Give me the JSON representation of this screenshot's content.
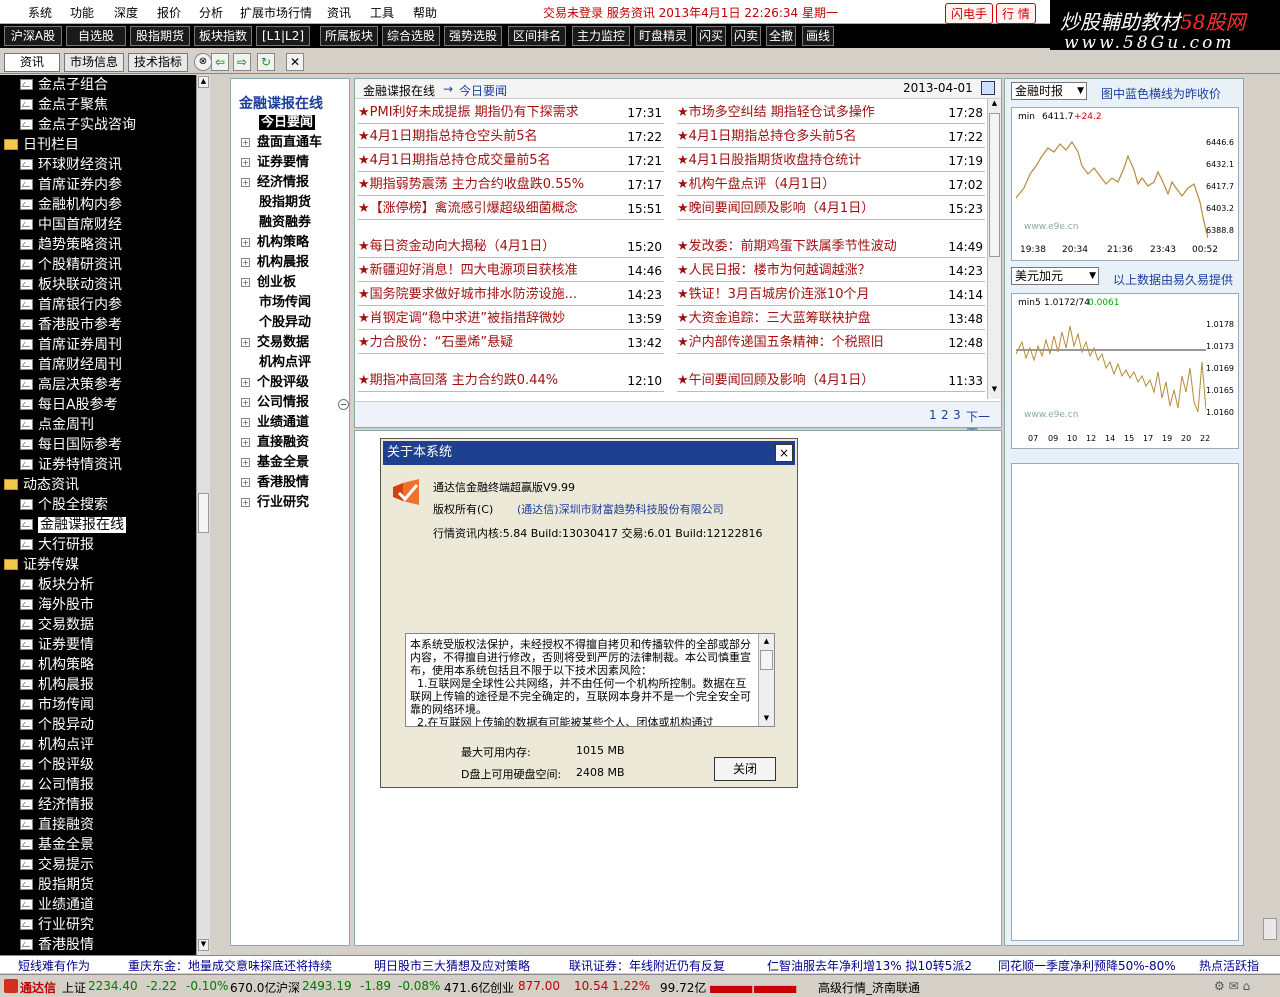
{
  "menu": {
    "items": [
      "系统",
      "功能",
      "深度",
      "报价",
      "分析",
      "扩展市场行情",
      "资讯",
      "工具",
      "帮助"
    ],
    "status": "交易未登录  服务资讯  2013年4月1日 22:26:34 星期一",
    "flash_btn": "闪电手",
    "quote_btn": "行 情"
  },
  "watermark": {
    "line1a": "炒股輔助教材",
    "line1b": "58股网",
    "line2": "www.58Gu.com"
  },
  "toolbar": [
    "沪深A股",
    "自选股",
    "股指期货",
    "板块指数",
    "[L1|L2]",
    "所属板块",
    "综合选股",
    "强势选股",
    "区间排名",
    "主力监控",
    "盯盘精灵",
    "闪买",
    "闪卖",
    "全撤",
    "画线"
  ],
  "tabs": {
    "info": "资讯",
    "market": "市场信息",
    "tech": "技术指标"
  },
  "left_tree": [
    {
      "label": "金点子组合",
      "type": "leaf"
    },
    {
      "label": "金点子聚焦",
      "type": "leaf"
    },
    {
      "label": "金点子实战咨询",
      "type": "leaf"
    },
    {
      "label": "日刊栏目",
      "type": "folder"
    },
    {
      "label": "环球财经资讯",
      "type": "leaf"
    },
    {
      "label": "首席证券内参",
      "type": "leaf"
    },
    {
      "label": "金融机构内参",
      "type": "leaf"
    },
    {
      "label": "中国首席财经",
      "type": "leaf"
    },
    {
      "label": "趋势策略资讯",
      "type": "leaf"
    },
    {
      "label": "个股精研资讯",
      "type": "leaf"
    },
    {
      "label": "板块联动资讯",
      "type": "leaf"
    },
    {
      "label": "首席银行内参",
      "type": "leaf"
    },
    {
      "label": "香港股市参考",
      "type": "leaf"
    },
    {
      "label": "首席证券周刊",
      "type": "leaf"
    },
    {
      "label": "首席财经周刊",
      "type": "leaf"
    },
    {
      "label": "高层决策参考",
      "type": "leaf"
    },
    {
      "label": "每日A股参考",
      "type": "leaf"
    },
    {
      "label": "点金周刊",
      "type": "leaf"
    },
    {
      "label": "每日国际参考",
      "type": "leaf"
    },
    {
      "label": "证券特情资讯",
      "type": "leaf"
    },
    {
      "label": "动态资讯",
      "type": "folder"
    },
    {
      "label": "个股全搜索",
      "type": "leaf"
    },
    {
      "label": "金融谍报在线",
      "type": "leaf",
      "selected": true
    },
    {
      "label": "大行研报",
      "type": "leaf"
    },
    {
      "label": "证券传媒",
      "type": "folder"
    },
    {
      "label": "板块分析",
      "type": "leaf"
    },
    {
      "label": "海外股市",
      "type": "leaf"
    },
    {
      "label": "交易数据",
      "type": "leaf"
    },
    {
      "label": "证券要情",
      "type": "leaf"
    },
    {
      "label": "机构策略",
      "type": "leaf"
    },
    {
      "label": "机构晨报",
      "type": "leaf"
    },
    {
      "label": "市场传闻",
      "type": "leaf"
    },
    {
      "label": "个股异动",
      "type": "leaf"
    },
    {
      "label": "机构点评",
      "type": "leaf"
    },
    {
      "label": "个股评级",
      "type": "leaf"
    },
    {
      "label": "公司情报",
      "type": "leaf"
    },
    {
      "label": "经济情报",
      "type": "leaf"
    },
    {
      "label": "直接融资",
      "type": "leaf"
    },
    {
      "label": "基金全景",
      "type": "leaf"
    },
    {
      "label": "交易提示",
      "type": "leaf"
    },
    {
      "label": "股指期货",
      "type": "leaf"
    },
    {
      "label": "业绩通道",
      "type": "leaf"
    },
    {
      "label": "行业研究",
      "type": "leaf"
    },
    {
      "label": "香港股情",
      "type": "leaf"
    }
  ],
  "category": {
    "title": "金融谍报在线",
    "items": [
      {
        "label": "今日要闻",
        "expand": false,
        "selected": true
      },
      {
        "label": "盘面直通车",
        "expand": true
      },
      {
        "label": "证券要情",
        "expand": true
      },
      {
        "label": "经济情报",
        "expand": true
      },
      {
        "label": "股指期货",
        "expand": false
      },
      {
        "label": "融资融券",
        "expand": false
      },
      {
        "label": "机构策略",
        "expand": true
      },
      {
        "label": "机构晨报",
        "expand": true
      },
      {
        "label": "创业板",
        "expand": true
      },
      {
        "label": "市场传闻",
        "expand": false
      },
      {
        "label": "个股异动",
        "expand": false
      },
      {
        "label": "交易数据",
        "expand": true
      },
      {
        "label": "机构点评",
        "expand": false
      },
      {
        "label": "个股评级",
        "expand": true
      },
      {
        "label": "公司情报",
        "expand": true
      },
      {
        "label": "业绩通道",
        "expand": true
      },
      {
        "label": "直接融资",
        "expand": true
      },
      {
        "label": "基金全景",
        "expand": true
      },
      {
        "label": "香港股情",
        "expand": true
      },
      {
        "label": "行业研究",
        "expand": true
      }
    ]
  },
  "news": {
    "breadcrumb_root": "金融谍报在线",
    "arrow": "→",
    "breadcrumb_current": "今日要闻",
    "date": "2013-04-01",
    "left": [
      {
        "title": "★PMI利好未成提振 期指仍有下探需求",
        "time": "17:31"
      },
      {
        "title": "★4月1日期指总持仓空头前5名",
        "time": "17:22"
      },
      {
        "title": "★4月1日期指总持仓成交量前5名",
        "time": "17:21"
      },
      {
        "title": "★期指弱势震荡 主力合约收盘跌0.55%",
        "time": "17:17"
      },
      {
        "title": "★【涨停榜】禽流感引爆超级细菌概念",
        "time": "15:51"
      },
      {
        "title": "★每日资金动向大揭秘（4月1日）",
        "time": "15:20"
      },
      {
        "title": "★新疆迎好消息！四大电源项目获核准",
        "time": "14:46"
      },
      {
        "title": "★国务院要求做好城市排水防涝设施...",
        "time": "14:23"
      },
      {
        "title": "★肖钢定调“稳中求进”被指措辞微妙",
        "time": "13:59"
      },
      {
        "title": "★力合股份：“石墨烯”悬疑",
        "time": "13:42"
      },
      {
        "title": "★期指冲高回落 主力合约跌0.44%",
        "time": "12:10"
      }
    ],
    "right": [
      {
        "title": "★市场多空纠结 期指轻仓试多操作",
        "time": "17:28"
      },
      {
        "title": "★4月1日期指总持仓多头前5名",
        "time": "17:22"
      },
      {
        "title": "★4月1日股指期货收盘持仓统计",
        "time": "17:19"
      },
      {
        "title": "★机构午盘点评（4月1日）",
        "time": "17:02"
      },
      {
        "title": "★晚间要闻回顾及影响（4月1日）",
        "time": "15:23"
      },
      {
        "title": "★发改委：前期鸡蛋下跌属季节性波动",
        "time": "14:49"
      },
      {
        "title": "★人民日报：楼市为何越调越涨？",
        "time": "14:23"
      },
      {
        "title": "★铁证！3月百城房价连涨10个月",
        "time": "14:14"
      },
      {
        "title": "★大资金追踪：三大蓝筹联袂护盘",
        "time": "13:48"
      },
      {
        "title": "★沪内部传递国五条精神：个税照旧",
        "time": "12:48"
      },
      {
        "title": "★午间要闻回顾及影响（4月1日）",
        "time": "11:33"
      }
    ],
    "pages": [
      "1",
      "2",
      "3"
    ],
    "next": "下一页"
  },
  "right_panel": {
    "select1": "金融时报",
    "hint1": "图中蓝色横线为昨收价",
    "chart1": {
      "label": "min",
      "price": "6411.7",
      "change": "+24.2",
      "yticks": [
        "6446.6",
        "6432.1",
        "6417.7",
        "6403.2",
        "6388.8"
      ],
      "xticks": [
        "19:38",
        "20:34",
        "21:36",
        "23:43",
        "00:52"
      ],
      "site": "www.e9e.cn"
    },
    "select2": "美元加元",
    "hint2": "以上数据由易久易提供",
    "chart2": {
      "label": "min5",
      "price": "1.0172/74",
      "change": "0.0061",
      "yticks": [
        "1.0178",
        "1.0173",
        "1.0169",
        "1.0165",
        "1.0160"
      ],
      "xticks": [
        "07",
        "09",
        "10",
        "12",
        "14",
        "15",
        "17",
        "19",
        "20",
        "22"
      ],
      "site": "www.e9e.cn"
    }
  },
  "dialog": {
    "title": "关于本系统",
    "close": "×",
    "product": "通达信金融终端超赢版V9.99",
    "copyright_label": "版权所有(C)",
    "copyright_owner": "(通达信)深圳市财富趋势科技股份有限公司",
    "version": "行情资讯内核:5.84 Build:13030417 交易:6.01 Build:12122816",
    "notice": "本系统受版权法保护，未经授权不得擅自拷贝和传播软件的全部或部分内容，不得擅自进行修改，否则将受到严厉的法律制裁。本公司慎重宣布，使用本系统包括且不限于以下技术因素风险：\n  1.互联网是全球性公共网络，并不由任何一个机构所控制。数据在互联网上传输的途径是不完全确定的，互联网本身并不是一个完全安全可靠的网络环境。\n  2.在互联网上传输的数据有可能被某些个人、团体或机构通过",
    "mem_label": "最大可用内存:",
    "mem_value": "1015 MB",
    "disk_label": "D盘上可用硬盘空间:",
    "disk_value": "2408 MB",
    "close_btn": "关闭"
  },
  "ticker": [
    "短线难有作为",
    "重庆东金：地量成交意味探底还将持续",
    "明日股市三大猜想及应对策略",
    "联讯证券：年线附近仍有反复",
    "仁智油服去年净利增13% 拟10转5派2",
    "同花顺一季度净利预降50%-80%",
    "热点活跃指"
  ],
  "indexbar": {
    "brand": "通达信",
    "sh_name": "上证",
    "sh_price": "2234.40",
    "sh_chg": "-2.22",
    "sh_pct": "-0.10%",
    "sh_amt": "670.0亿",
    "hs_name": "沪深",
    "hs_price": "2493.19",
    "hs_chg": "-1.89",
    "hs_pct": "-0.08%",
    "hs_amt": "471.6亿",
    "cy_name": "创业",
    "cy_price": "877.00",
    "cy_chg": "10.54",
    "cy_pct": "1.22%",
    "cy_amt": "99.72亿",
    "server": "高级行情_济南联通"
  }
}
